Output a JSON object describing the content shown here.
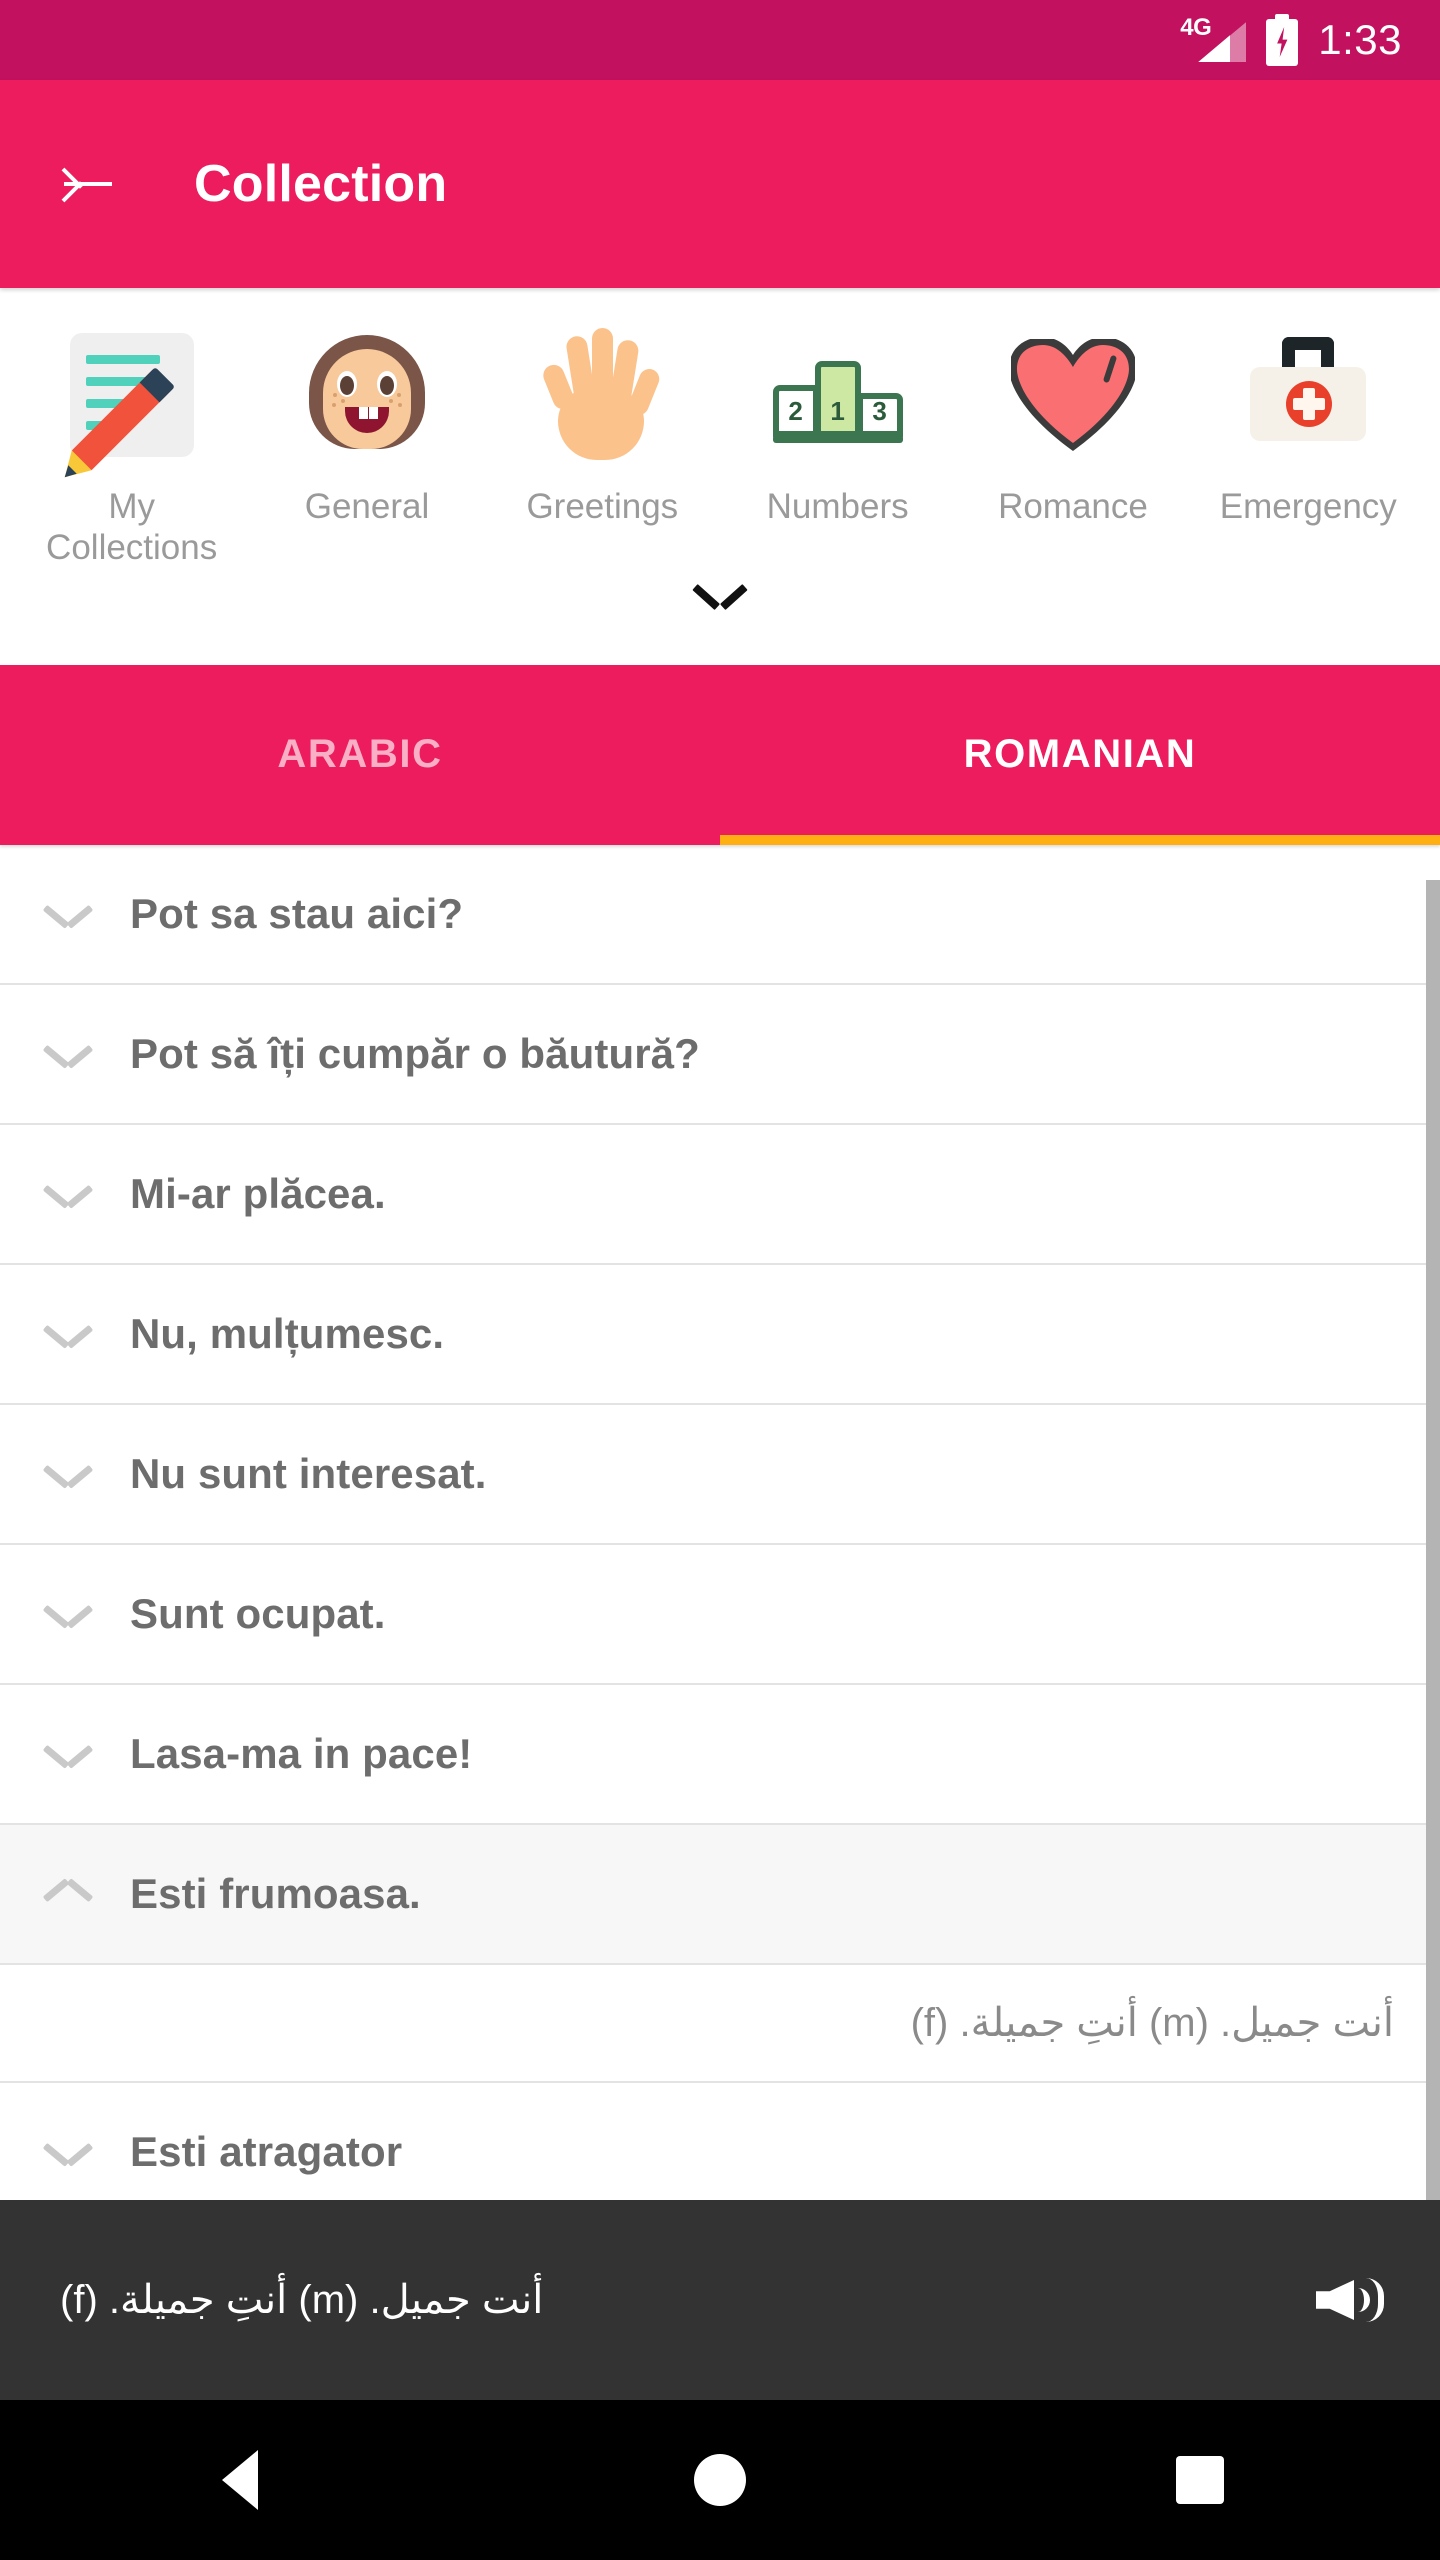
{
  "status_bar": {
    "network_label": "4G",
    "time": "1:33",
    "battery_state": "charging",
    "background_color": "#C2115F"
  },
  "app_bar": {
    "back_label": "Back",
    "title": "Collection",
    "background_color": "#EC1C5F"
  },
  "categories": {
    "items": [
      {
        "label": "My Collections",
        "icon": "memo-icon"
      },
      {
        "label": "General",
        "icon": "girl-face-icon"
      },
      {
        "label": "Greetings",
        "icon": "raised-hand-icon"
      },
      {
        "label": "Numbers",
        "icon": "podium-icon"
      },
      {
        "label": "Romance",
        "icon": "heart-icon"
      },
      {
        "label": "Emergency",
        "icon": "first-aid-kit-icon"
      }
    ],
    "expand_icon": "chevron-down-icon"
  },
  "tabs": {
    "items": [
      {
        "label": "ARABIC",
        "active": false
      },
      {
        "label": "ROMANIAN",
        "active": true
      }
    ],
    "indicator_color": "#FFAF12"
  },
  "phrase_list": {
    "rows": [
      {
        "text": "Pot sa stau aici?",
        "expanded": false
      },
      {
        "text": "Pot să îți cumpăr o băutură?",
        "expanded": false
      },
      {
        "text": "Mi-ar plăcea.",
        "expanded": false
      },
      {
        "text": "Nu, mulțumesc.",
        "expanded": false
      },
      {
        "text": "Nu sunt interesat.",
        "expanded": false
      },
      {
        "text": "Sunt ocupat.",
        "expanded": false
      },
      {
        "text": "Lasa-ma in pace!",
        "expanded": false
      },
      {
        "text": "Esti frumoasa.",
        "expanded": true
      },
      {
        "text": "Esti atragator",
        "expanded": false
      }
    ],
    "expanded_translation": "أنت جميل. (m)  أنتِ جميلة. (f)"
  },
  "player": {
    "text": "أنت جميل. (m)  أنتِ جميلة. (f)",
    "speaker_icon": "speaker-icon",
    "background_color": "#333333"
  },
  "nav_bar": {
    "back": "back-triangle-icon",
    "home": "home-circle-icon",
    "recents": "recents-square-icon"
  }
}
